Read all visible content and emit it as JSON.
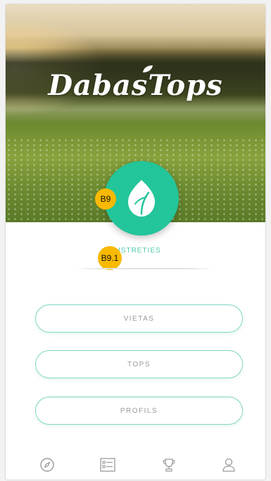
{
  "app": {
    "logo_text": "DabasTops",
    "subtitle": "ISTRETIES"
  },
  "markers": {
    "primary": "B9",
    "secondary": "B9.1"
  },
  "menu": {
    "items": [
      {
        "label": "VIETAS"
      },
      {
        "label": "TOPS"
      },
      {
        "label": "PROFILS"
      }
    ]
  },
  "tabbar": {
    "items": [
      {
        "icon": "compass-icon"
      },
      {
        "icon": "list-icon"
      },
      {
        "icon": "trophy-icon"
      },
      {
        "icon": "user-icon"
      }
    ]
  },
  "colors": {
    "accent": "#23c59a",
    "button_border": "#7ed6c3",
    "marker": "#f8b900"
  }
}
